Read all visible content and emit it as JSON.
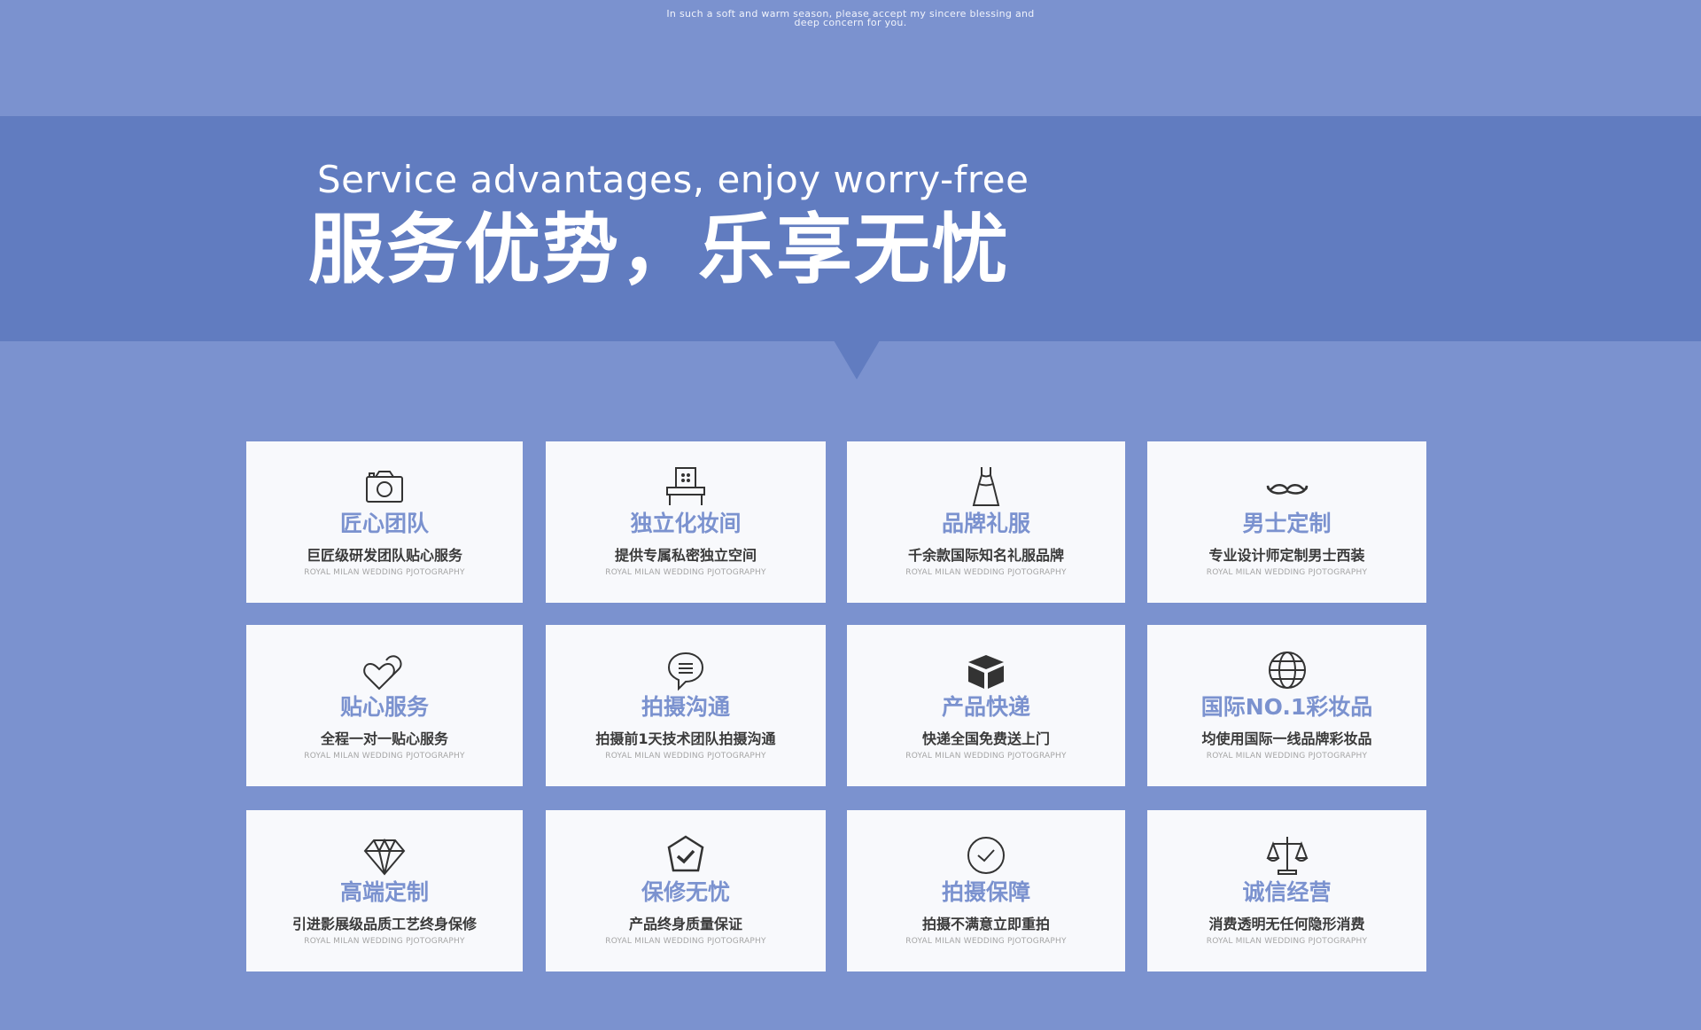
{
  "top": {
    "blessing_line1": "In such a soft and warm season, please accept my sincere blessing and",
    "blessing_line2": "deep concern for you."
  },
  "banner": {
    "title_en": "Service advantages, enjoy worry-free",
    "title_cn": "服务优势，乐享无忧"
  },
  "colors": {
    "page_bg": "#7b92cf",
    "banner_bg": "#617cc0",
    "card_bg": "#f8f9fc",
    "title_accent": "#7b92cf",
    "desc_text": "#3a3a3a",
    "sub_text": "#a5a5a5"
  },
  "cards": [
    {
      "icon": "camera-icon",
      "title": "匠心团队",
      "desc": "巨匠级研发团队贴心服务",
      "sub": "ROYAL MILAN WEDDING PJOTOGRAPHY"
    },
    {
      "icon": "vanity-mirror-icon",
      "title": "独立化妆间",
      "desc": "提供专属私密独立空间",
      "sub": "ROYAL MILAN WEDDING PJOTOGRAPHY"
    },
    {
      "icon": "dress-icon",
      "title": "品牌礼服",
      "desc": "千余款国际知名礼服品牌",
      "sub": "ROYAL MILAN WEDDING PJOTOGRAPHY"
    },
    {
      "icon": "mustache-icon",
      "title": "男士定制",
      "desc": "专业设计师定制男士西装",
      "sub": "ROYAL MILAN WEDDING PJOTOGRAPHY"
    },
    {
      "icon": "two-hearts-icon",
      "title": "贴心服务",
      "desc": "全程一对一贴心服务",
      "sub": "ROYAL MILAN WEDDING PJOTOGRAPHY"
    },
    {
      "icon": "chat-bubble-icon",
      "title": "拍摄沟通",
      "desc": "拍摄前1天技术团队拍摄沟通",
      "sub": "ROYAL MILAN WEDDING PJOTOGRAPHY"
    },
    {
      "icon": "package-box-icon",
      "title": "产品快递",
      "desc": "快递全国免费送上门",
      "sub": "ROYAL MILAN WEDDING PJOTOGRAPHY"
    },
    {
      "icon": "globe-icon",
      "title": "国际NO.1彩妆品",
      "desc": "均使用国际一线品牌彩妆品",
      "sub": "ROYAL MILAN WEDDING PJOTOGRAPHY"
    },
    {
      "icon": "diamond-icon",
      "title": "高端定制",
      "desc": "引进影展级品质工艺终身保修",
      "sub": "ROYAL MILAN WEDDING PJOTOGRAPHY"
    },
    {
      "icon": "shield-check-icon",
      "title": "保修无忧",
      "desc": "产品终身质量保证",
      "sub": "ROYAL MILAN WEDDING PJOTOGRAPHY"
    },
    {
      "icon": "check-circle-icon",
      "title": "拍摄保障",
      "desc": "拍摄不满意立即重拍",
      "sub": "ROYAL MILAN WEDDING PJOTOGRAPHY"
    },
    {
      "icon": "balance-scale-icon",
      "title": "诚信经营",
      "desc": "消费透明无任何隐形消费",
      "sub": "ROYAL MILAN WEDDING PJOTOGRAPHY"
    }
  ]
}
